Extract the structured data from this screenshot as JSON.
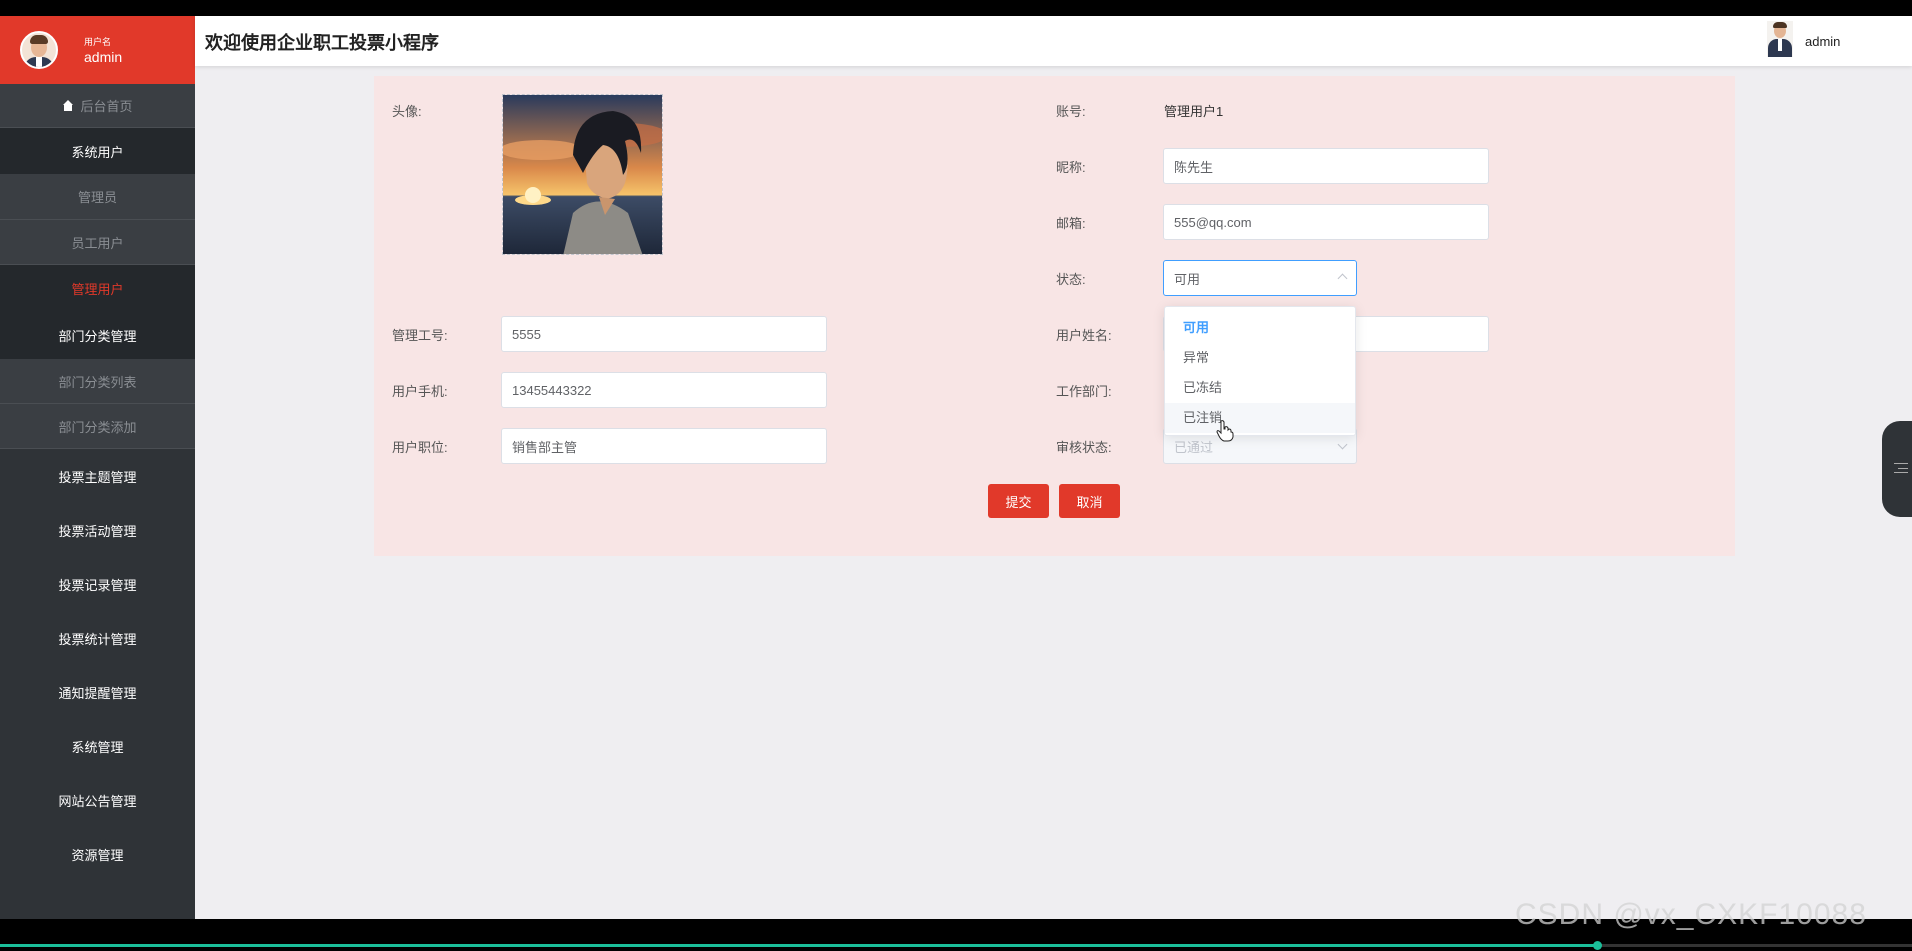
{
  "sidebar": {
    "user_label": "用户名",
    "user_name": "admin",
    "items": [
      {
        "label": "后台首页",
        "kind": "home"
      },
      {
        "label": "系统用户",
        "kind": "group"
      },
      {
        "label": "管理员",
        "kind": "sub"
      },
      {
        "label": "员工用户",
        "kind": "sub"
      },
      {
        "label": "管理用户",
        "kind": "active"
      },
      {
        "label": "部门分类管理",
        "kind": "group"
      },
      {
        "label": "部门分类列表",
        "kind": "sub"
      },
      {
        "label": "部门分类添加",
        "kind": "sub"
      },
      {
        "label": "投票主题管理",
        "kind": "group"
      },
      {
        "label": "投票活动管理",
        "kind": "group"
      },
      {
        "label": "投票记录管理",
        "kind": "group"
      },
      {
        "label": "投票统计管理",
        "kind": "group"
      },
      {
        "label": "通知提醒管理",
        "kind": "group"
      },
      {
        "label": "系统管理",
        "kind": "group"
      },
      {
        "label": "网站公告管理",
        "kind": "group"
      },
      {
        "label": "资源管理",
        "kind": "group"
      }
    ]
  },
  "header": {
    "title": "欢迎使用企业职工投票小程序",
    "user": "admin"
  },
  "form": {
    "avatar_label": "头像:",
    "account_label": "账号:",
    "account_value": "管理用户1",
    "nickname_label": "昵称:",
    "nickname_value": "陈先生",
    "email_label": "邮箱:",
    "email_value": "555@qq.com",
    "status_label": "状态:",
    "status_value": "可用",
    "staff_no_label": "管理工号:",
    "staff_no_value": "5555",
    "real_name_label": "用户姓名:",
    "phone_label": "用户手机:",
    "phone_value": "13455443322",
    "dept_label": "工作部门:",
    "position_label": "用户职位:",
    "position_value": "销售部主管",
    "review_label": "审核状态:",
    "review_value": "已通过",
    "submit": "提交",
    "cancel": "取消"
  },
  "status_options": [
    "可用",
    "异常",
    "已冻结",
    "已注销"
  ],
  "video": {
    "watermark": "CSDN @vx_CXKF10088",
    "progress": 0.835
  },
  "colors": {
    "accent": "#e1392a",
    "sidebar_bg": "#2f3337",
    "select_blue": "#409eff"
  }
}
